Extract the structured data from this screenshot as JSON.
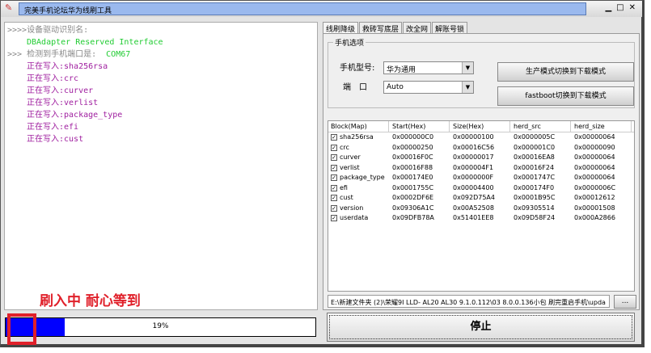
{
  "window": {
    "title": "完美手机论坛华为线刷工具",
    "minimize": "▁",
    "maximize": "□",
    "close": "✕"
  },
  "log": [
    {
      "text": ">>>>设备驱动识别名:",
      "cls": "gray"
    },
    {
      "text": "DBAdapter Reserved Interface",
      "cls": "green indent"
    },
    {
      "prefix": ">>> 检测到手机端口是:  ",
      "value": "COM67"
    },
    {
      "text": "正在写入:sha256rsa",
      "cls": "purple indent"
    },
    {
      "text": "正在写入:crc",
      "cls": "purple indent"
    },
    {
      "text": "正在写入:curver",
      "cls": "purple indent"
    },
    {
      "text": "正在写入:verlist",
      "cls": "purple indent"
    },
    {
      "text": "正在写入:package_type",
      "cls": "purple indent"
    },
    {
      "text": "正在写入:efi",
      "cls": "purple indent"
    },
    {
      "text": "正在写入:cust",
      "cls": "purple indent"
    }
  ],
  "notice": "刷入中 耐心等到",
  "progress": {
    "percent": 19,
    "label": "19%"
  },
  "tabs": [
    "线刷降级",
    "救砖写底层",
    "改全网",
    "解账号锁"
  ],
  "phone_options": {
    "legend": "手机选项",
    "model_label": "手机型号:",
    "model_value": "华为通用",
    "port_label": "端　口",
    "port_value": "Auto",
    "btn_prod": "生产模式切换到下载模式",
    "btn_fastboot": "fastboot切换到下载模式"
  },
  "table": {
    "headers": [
      "Block(Map)",
      "Start(Hex)",
      "Size(Hex)",
      "herd_src",
      "herd_size"
    ],
    "rows": [
      [
        "sha256rsa",
        "0x000000C0",
        "0x00000100",
        "0x0000005C",
        "0x00000064"
      ],
      [
        "crc",
        "0x00000250",
        "0x00016C56",
        "0x000001C0",
        "0x00000090"
      ],
      [
        "curver",
        "0x00016F0C",
        "0x00000017",
        "0x00016EA8",
        "0x00000064"
      ],
      [
        "verlist",
        "0x00016F88",
        "0x000004F1",
        "0x00016F24",
        "0x00000064"
      ],
      [
        "package_type",
        "0x000174E0",
        "0x0000000F",
        "0x0001747C",
        "0x00000064"
      ],
      [
        "efi",
        "0x0001755C",
        "0x00004400",
        "0x000174F0",
        "0x0000006C"
      ],
      [
        "cust",
        "0x0002DF6E",
        "0x092D75A4",
        "0x0001B95C",
        "0x00012612"
      ],
      [
        "version",
        "0x09306A1C",
        "0x00A52508",
        "0x09305514",
        "0x00001508"
      ],
      [
        "userdata",
        "0x09DFB78A",
        "0x51401EE8",
        "0x09D58F24",
        "0x000A2866"
      ]
    ]
  },
  "file_path": "E:\\新建文件夹 (2)\\荣耀9I LLD- AL20 AL30 9.1.0.112\\03 8.0.0.136小包 刷完重启手机\\upda",
  "browse_label": "...",
  "stop_label": "停止"
}
